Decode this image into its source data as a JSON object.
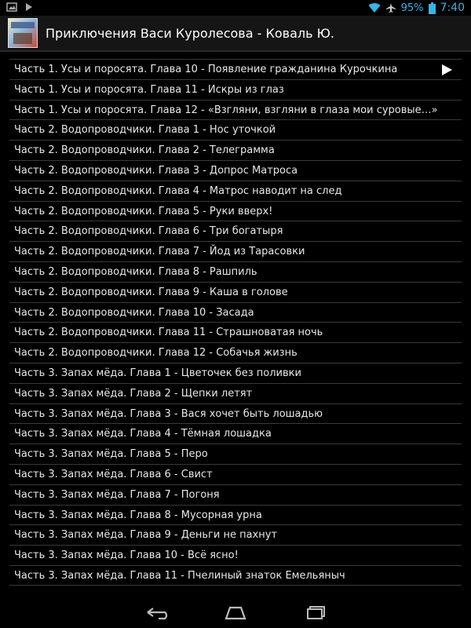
{
  "status": {
    "battery": "95%",
    "time": "7:40"
  },
  "header": {
    "title": "Приключения Васи Куролесова  -  Коваль Ю."
  },
  "chapters": [
    "Часть 1. Усы и поросята. Глава 10 - Появление гражданина Курочкина",
    "Часть 1. Усы и поросята. Глава 11 - Искры из глаз",
    "Часть 1. Усы и поросята. Глава 12 - «Взгляни, взгляни в глаза мои суровые…»",
    "Часть 2. Водопроводчики. Глава 1 - Нос уточкой",
    "Часть 2. Водопроводчики. Глава 2 - Телеграмма",
    "Часть 2. Водопроводчики. Глава 3 - Допрос Матроса",
    "Часть 2. Водопроводчики. Глава 4 - Матрос наводит на след",
    "Часть 2. Водопроводчики. Глава 5 - Руки вверх!",
    "Часть 2. Водопроводчики. Глава 6 - Три богатыря",
    "Часть 2. Водопроводчики. Глава 7 - Йод из Тарасовки",
    "Часть 2. Водопроводчики. Глава 8 - Рашпиль",
    "Часть 2. Водопроводчики. Глава 9 - Каша в голове",
    "Часть 2. Водопроводчики. Глава 10 - Засада",
    "Часть 2. Водопроводчики. Глава 11 - Страшноватая ночь",
    "Часть 2. Водопроводчики. Глава 12 - Собачья жизнь",
    "Часть 3. Запах мёда. Глава 1 - Цветочек без поливки",
    "Часть 3. Запах мёда. Глава 2 - Щепки летят",
    "Часть 3. Запах мёда. Глава 3 - Вася хочет быть лошадью",
    "Часть 3. Запах мёда. Глава 4 - Тёмная лошадка",
    "Часть 3. Запах мёда. Глава 5 - Перо",
    "Часть 3. Запах мёда. Глава 6 - Свист",
    "Часть 3. Запах мёда. Глава 7 - Погоня",
    "Часть 3. Запах мёда. Глава 8 - Мусорная урна",
    "Часть 3. Запах мёда. Глава 9 - Деньги не пахнут",
    "Часть 3. Запах мёда. Глава 10 - Всё ясно!",
    "Часть 3. Запах мёда. Глава 11 - Пчелиный знаток Емельяныч"
  ]
}
